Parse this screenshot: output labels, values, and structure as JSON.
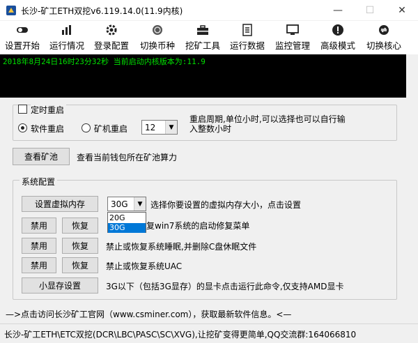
{
  "window": {
    "title": "长沙-矿工ETH双挖v6.119.14.0(11.9内核)",
    "controls": {
      "minimize": "—",
      "maximize": "☐",
      "close": "✕"
    }
  },
  "toolbar": [
    {
      "id": "start",
      "label": "设置开始",
      "icon": "toggle-icon"
    },
    {
      "id": "status",
      "label": "运行情况",
      "icon": "bar-chart-icon"
    },
    {
      "id": "login",
      "label": "登录配置",
      "icon": "gear-icon"
    },
    {
      "id": "coin",
      "label": "切换币种",
      "icon": "coin-icon"
    },
    {
      "id": "tools",
      "label": "挖矿工具",
      "icon": "toolbox-icon"
    },
    {
      "id": "data",
      "label": "运行数据",
      "icon": "document-icon"
    },
    {
      "id": "monitor",
      "label": "监控管理",
      "icon": "monitor-icon"
    },
    {
      "id": "advanced",
      "label": "高级模式",
      "icon": "alert-icon"
    },
    {
      "id": "core",
      "label": "切换核心",
      "icon": "switch-icon"
    }
  ],
  "console": {
    "line": "2018年8月24日16时23分32秒 当前启动内核版本为:11.9"
  },
  "restart": {
    "timer_label": "定时重启",
    "software_restart": "软件重启",
    "machine_restart": "矿机重启",
    "hours_value": "12",
    "cycle_text_line1": "重启周期,单位小时,可以选择也可以自行输",
    "cycle_text_line2": "入整数小时"
  },
  "pool": {
    "button": "查看矿池",
    "description": "查看当前钱包所在矿池算力"
  },
  "system": {
    "group_title": "系统配置",
    "virtual_memory_button": "设置虚拟内存",
    "memory_value": "30G",
    "memory_desc": "选择你要设置的虚拟内存大小，点击设置",
    "dropdown_options": [
      "20G",
      "30G"
    ],
    "disable_label": "禁用",
    "restore_label": "恢复",
    "row1_desc_visible": "复win7系统的启动修复菜单",
    "row2_desc": "禁止或恢复系统睡眠,并删除C盘休眠文件",
    "row3_desc": "禁止或恢复系统UAC",
    "small_vram_button": "小显存设置",
    "small_vram_desc": "3G以下（包括3G显存）的显卡点击运行此命令,仅支持AMD显卡"
  },
  "link": {
    "text": "—>点击访问长沙矿工官网（www.csminer.com），获取最新软件信息。<—"
  },
  "statusbar": {
    "text": "长沙-矿工ETH\\ETC双挖(DCR\\LBC\\PASC\\SC\\XVG),让挖矿变得更简单,QQ交流群:164066810"
  },
  "colors": {
    "console_bg": "#000000",
    "console_text": "#00e000",
    "selection": "#0078d7"
  }
}
